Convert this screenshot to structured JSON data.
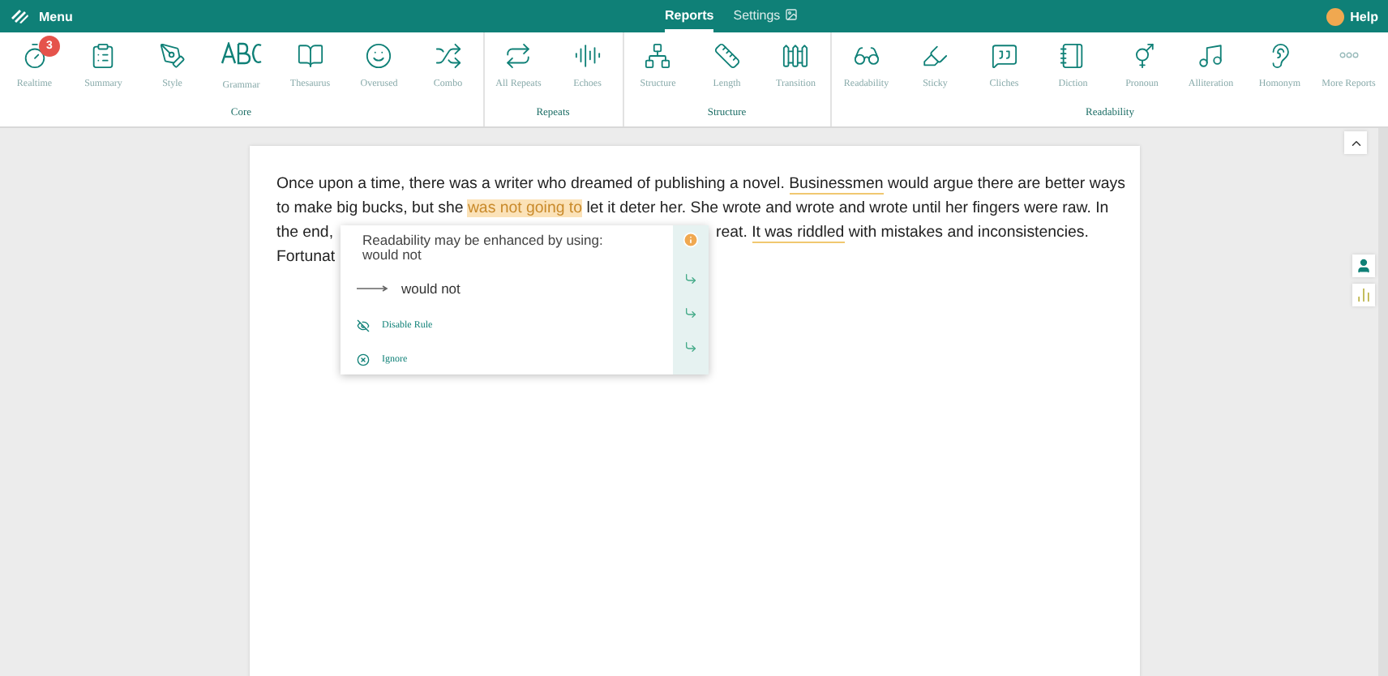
{
  "topbar": {
    "menu": "Menu",
    "tabs": [
      {
        "label": "Reports",
        "selected": true
      },
      {
        "label": "Settings",
        "selected": false
      }
    ],
    "help": "Help"
  },
  "groups": [
    {
      "label": "Core",
      "tools": [
        {
          "label": "Realtime",
          "badge": "3"
        },
        {
          "label": "Summary"
        },
        {
          "label": "Style"
        },
        {
          "label": "Grammar"
        },
        {
          "label": "Thesaurus"
        },
        {
          "label": "Overused"
        },
        {
          "label": "Combo"
        }
      ]
    },
    {
      "label": "Repeats",
      "tools": [
        {
          "label": "All Repeats"
        },
        {
          "label": "Echoes"
        }
      ]
    },
    {
      "label": "Structure",
      "tools": [
        {
          "label": "Structure"
        },
        {
          "label": "Length"
        },
        {
          "label": "Transition"
        }
      ]
    },
    {
      "label": "Readability",
      "tools": [
        {
          "label": "Readability"
        },
        {
          "label": "Sticky"
        },
        {
          "label": "Cliches"
        },
        {
          "label": "Diction"
        },
        {
          "label": "Pronoun"
        },
        {
          "label": "Alliteration"
        },
        {
          "label": "Homonym"
        },
        {
          "label": "More Reports"
        }
      ]
    }
  ],
  "document": {
    "lines": [
      {
        "segments": [
          {
            "text": "Once upon a time, there was a writer who dreamed of publishing a novel. ",
            "kind": "plain"
          },
          {
            "text": "Businessmen",
            "kind": "underline"
          },
          {
            "text": " would argue there are better ways",
            "kind": "plain"
          }
        ]
      },
      {
        "segments": [
          {
            "text": "to make big bucks, but she ",
            "kind": "plain"
          },
          {
            "text": "was not going to",
            "kind": "highlight"
          },
          {
            "text": " let it deter her. She wrote and wrote and wrote until her fingers were raw. In",
            "kind": "plain"
          }
        ]
      },
      {
        "segments": [
          {
            "text": "the end,",
            "kind": "plain"
          },
          {
            "text": "reat. ",
            "kind": "resume"
          },
          {
            "text": "It was riddled",
            "kind": "underline"
          },
          {
            "text": " with mistakes and inconsistencies.",
            "kind": "plain"
          }
        ]
      },
      {
        "segments": [
          {
            "text": "Fortunat",
            "kind": "plain"
          }
        ]
      }
    ]
  },
  "popup": {
    "message": "Readability may be enhanced by using:",
    "suggestion_hint": "would not",
    "actions": [
      {
        "label": "would not",
        "kind": "replace"
      },
      {
        "label": "Disable Rule",
        "kind": "disable"
      },
      {
        "label": "Ignore",
        "kind": "ignore"
      }
    ]
  }
}
